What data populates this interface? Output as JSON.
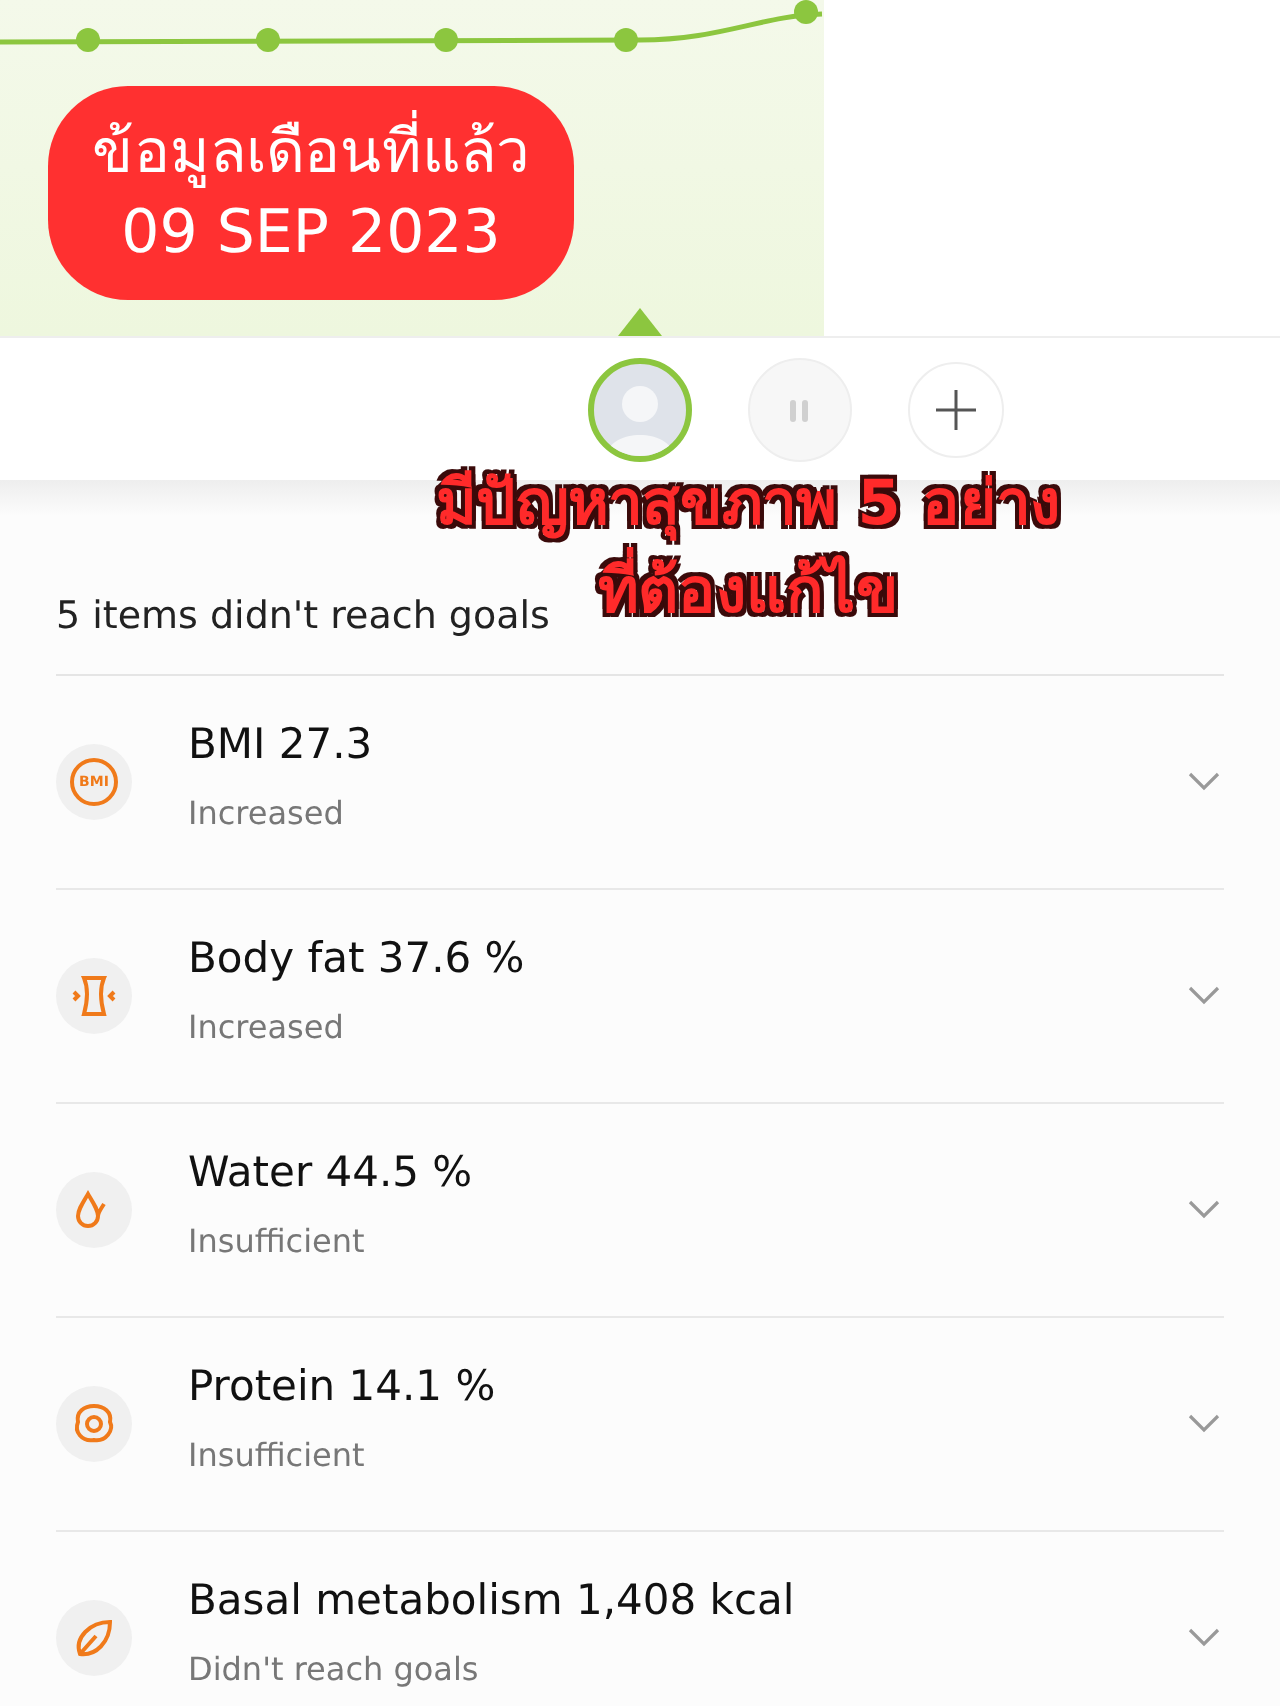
{
  "overlay": {
    "badge_lines": [
      "ข้อมูลเดือนที่แล้ว",
      "09 SEP 2023"
    ],
    "caption_lines": [
      "มีปัญหาสุขภาพ 5 อย่าง",
      "ที่ต้องแก้ไข"
    ]
  },
  "profiles": [
    {
      "kind": "avatar",
      "selected": true
    },
    {
      "kind": "mode",
      "selected": false
    },
    {
      "kind": "add",
      "selected": false
    }
  ],
  "summary": "5 items didn't reach goals",
  "items": [
    {
      "kind": "bmi",
      "icon_label": "BMI",
      "title": "BMI 27.3",
      "status": "Increased",
      "expanded": false
    },
    {
      "kind": "body_fat",
      "title": "Body fat 37.6 %",
      "status": "Increased",
      "expanded": false
    },
    {
      "kind": "water",
      "title": "Water 44.5 %",
      "status": "Insufficient",
      "expanded": false
    },
    {
      "kind": "protein",
      "title": "Protein 14.1 %",
      "status": "Insufficient",
      "expanded": false
    },
    {
      "kind": "metabolism",
      "title": "Basal metabolism 1,408 kcal",
      "status": "Didn't reach goals",
      "expanded": false
    }
  ]
}
